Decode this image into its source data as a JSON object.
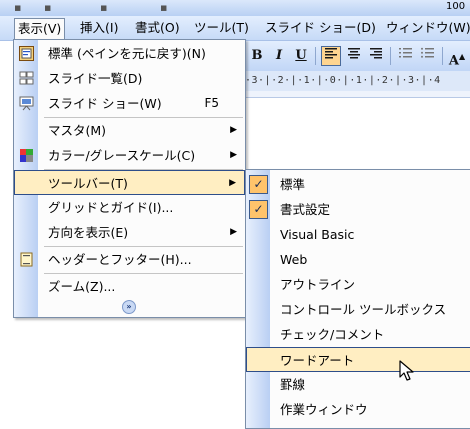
{
  "menubar": {
    "items": [
      {
        "label": "表示(V)"
      },
      {
        "label": "挿入(I)"
      },
      {
        "label": "書式(O)"
      },
      {
        "label": "ツール(T)"
      },
      {
        "label": "スライド ショー(D)"
      },
      {
        "label": "ウィンドウ(W)"
      }
    ],
    "active_index": 0
  },
  "toolbar_strip": {
    "zoom_text": "100"
  },
  "format_toolbar": {
    "bold": "B",
    "italic": "I",
    "underline": "U",
    "font_grow": "A"
  },
  "ruler": {
    "text": "·3·|·2·|·1·|·0·|·1·|·2·|·3·|·4"
  },
  "view_menu": {
    "items": [
      {
        "label": "標準 (ペインを元に戻す)(N)",
        "icon": "normal-view-icon"
      },
      {
        "label": "スライド一覧(D)",
        "icon": "slide-sorter-icon"
      },
      {
        "label": "スライド ショー(W)",
        "shortcut": "F5",
        "icon": "slide-show-icon"
      },
      {
        "label": "マスタ(M)",
        "submenu": true
      },
      {
        "label": "カラー/グレースケール(C)",
        "submenu": true,
        "icon": "color-grayscale-icon"
      },
      {
        "label": "ツールバー(T)",
        "submenu": true,
        "highlighted": true
      },
      {
        "label": "グリッドとガイド(I)..."
      },
      {
        "label": "方向を表示(E)",
        "submenu": true
      },
      {
        "label": "ヘッダーとフッター(H)...",
        "icon": "header-footer-icon"
      },
      {
        "label": "ズーム(Z)..."
      }
    ],
    "expand_glyph": "»"
  },
  "toolbars_submenu": {
    "items": [
      {
        "label": "標準",
        "checked": true
      },
      {
        "label": "書式設定",
        "checked": true
      },
      {
        "label": "Visual Basic"
      },
      {
        "label": "Web"
      },
      {
        "label": "アウトライン"
      },
      {
        "label": "コントロール ツールボックス"
      },
      {
        "label": "チェック/コメント"
      },
      {
        "label": "ワードアート",
        "highlighted": true
      },
      {
        "label": "罫線"
      },
      {
        "label": "作業ウィンドウ"
      }
    ]
  },
  "colors": {
    "highlight_bg": "#ffeec2",
    "highlight_border": "#2e4e8a",
    "menubar_bg": "#c6daf7",
    "gutter": "#b9cff3",
    "check_bg": "#ffc36b"
  }
}
